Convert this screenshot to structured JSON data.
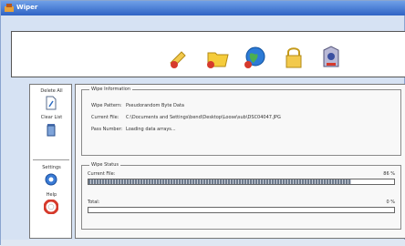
{
  "window": {
    "title": "Wiper"
  },
  "toolbar": {
    "icons": [
      "wipe-wand-icon",
      "folder-icon",
      "globe-icon",
      "lock-icon",
      "trash-bin-icon"
    ]
  },
  "sidebar": {
    "delete_all": "Delete All",
    "clear_list": "Clear List",
    "settings": "Settings",
    "help": "Help"
  },
  "wipe_information": {
    "title": "Wipe Information",
    "wipe_pattern_label": "Wipe Pattern:",
    "wipe_pattern_value": "Pseudorandom Byte Data",
    "current_file_label": "Current File:",
    "current_file_value": "C:\\Documents and Settings\\bend\\Desktop\\Loose\\sub\\DSC04047.JPG",
    "pass_number_label": "Pass Number:",
    "pass_number_value": "Loading data arrays..."
  },
  "wipe_status": {
    "title": "Wipe Status",
    "current_file_label": "Current File:",
    "current_file_percent": "86 %",
    "current_file_progress": 0.86,
    "total_label": "Total:",
    "total_percent": "0 %",
    "total_progress": 0.0
  },
  "colors": {
    "titlebar": "#2f63c4",
    "window_bg": "#d6e2f3",
    "progress": "#6d7a8c"
  }
}
